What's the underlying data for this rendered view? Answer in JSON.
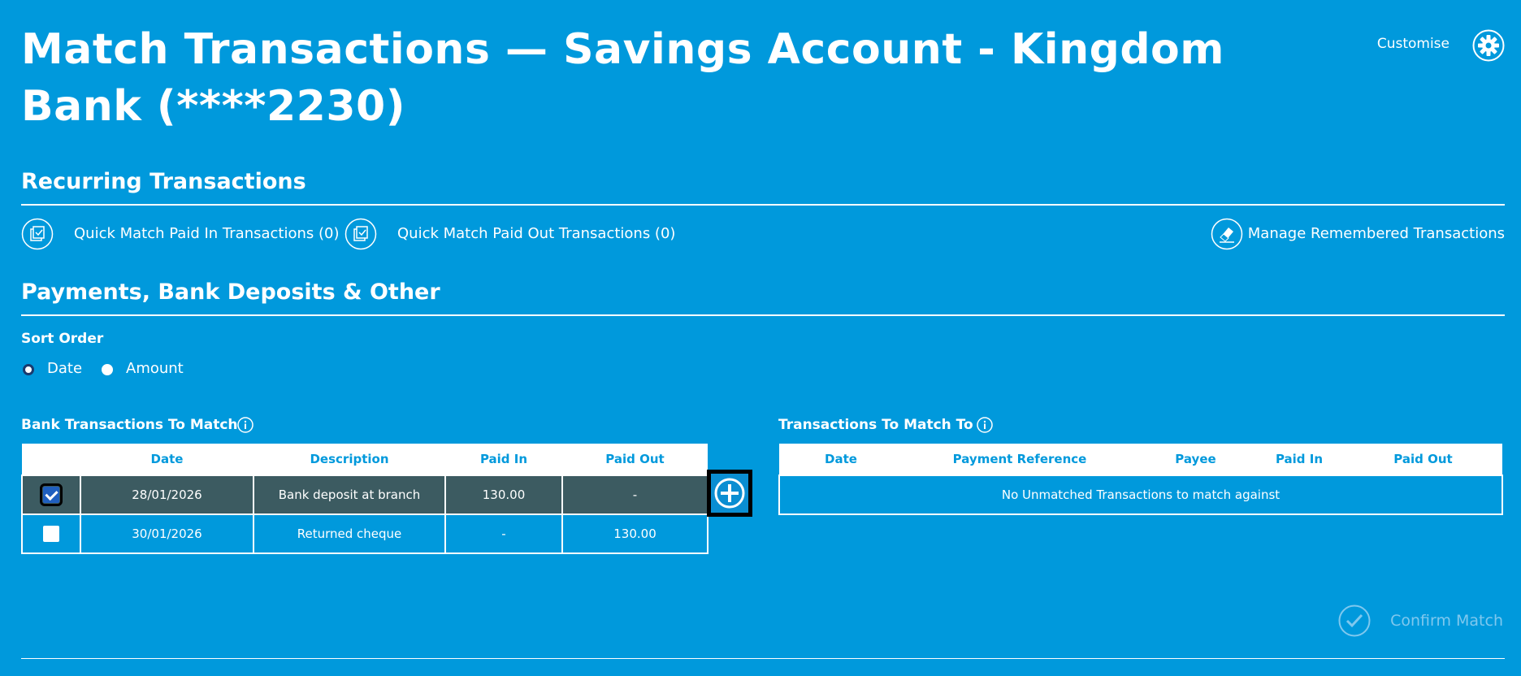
{
  "header": {
    "title": "Match Transactions — Savings Account - Kingdom Bank (****2230)",
    "customise_label": "Customise",
    "gear_icon": "gear-icon"
  },
  "recurring": {
    "title": "Recurring Transactions",
    "quick_paid_in": "Quick Match Paid In Transactions (0)",
    "quick_paid_out": "Quick Match Paid Out Transactions (0)",
    "manage_remembered": "Manage Remembered Transactions"
  },
  "payments": {
    "title": "Payments, Bank Deposits & Other",
    "sort_order_label": "Sort Order",
    "sort_options": [
      "Date",
      "Amount"
    ],
    "sort_selected": "Date"
  },
  "bank_table": {
    "title": "Bank Transactions To Match",
    "columns": [
      "",
      "Date",
      "Description",
      "Paid In",
      "Paid Out"
    ],
    "rows": [
      {
        "checked": true,
        "date": "28/01/2026",
        "description": "Bank deposit at branch",
        "paid_in": "130.00",
        "paid_out": "-"
      },
      {
        "checked": false,
        "date": "30/01/2026",
        "description": "Returned cheque",
        "paid_in": "-",
        "paid_out": "130.00"
      }
    ]
  },
  "match_table": {
    "title": "Transactions To Match To",
    "columns": [
      "Date",
      "Payment Reference",
      "Payee",
      "Paid In",
      "Paid Out"
    ],
    "empty_message": "No Unmatched Transactions to match against"
  },
  "footer": {
    "confirm_label": "Confirm Match"
  },
  "colors": {
    "background": "#0099dc",
    "selected_row": "#3c5b61",
    "disabled_text": "#7fc8ee"
  }
}
